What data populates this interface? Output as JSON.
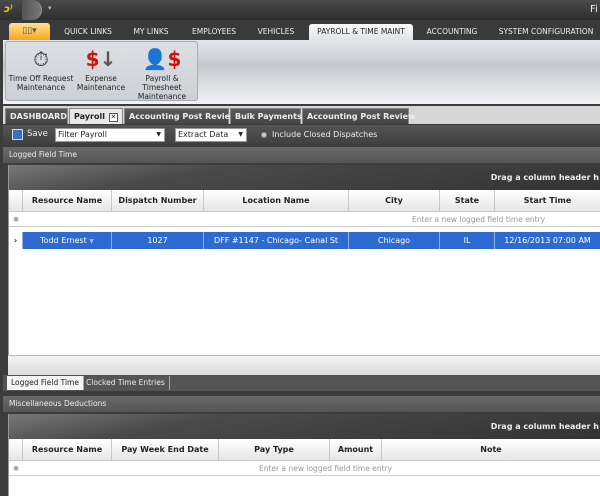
{
  "window": {
    "title": "Fi"
  },
  "ribbon": {
    "tabs": [
      "QUICK LINKS",
      "MY LINKS",
      "EMPLOYEES",
      "VEHICLES",
      "PAYROLL & TIME MAINT",
      "ACCOUNTING",
      "SYSTEM CONFIGURATION"
    ],
    "selected_tab": "PAYROLL & TIME MAINT",
    "buttons": [
      {
        "label1": "Time Off Request",
        "label2": "Maintenance",
        "icon": "stopwatch-icon"
      },
      {
        "label1": "Expense",
        "label2": "Maintenance",
        "icon": "dollar-down-icon"
      },
      {
        "label1": "Payroll & Timesheet",
        "label2": "Maintenance",
        "icon": "person-dollar-icon"
      }
    ]
  },
  "doc_tabs": [
    "DASHBOARD",
    "Payroll",
    "Accounting Post Review",
    "Bulk Payments",
    "Accounting Post Review"
  ],
  "toolbar": {
    "save": "Save",
    "filter": "Filter Payroll",
    "extract": "Extract Data",
    "include_closed": "Include Closed Dispatches"
  },
  "logged": {
    "header": "Logged Field Time",
    "group_hint": "Drag a column header h",
    "columns": [
      "Resource Name",
      "Dispatch Number",
      "Location Name",
      "City",
      "State",
      "Start Time"
    ],
    "new_row": "Enter a new logged field time entry",
    "rows": [
      {
        "resource": "Todd  Ernest",
        "dispatch": "1027",
        "location": "DFF #1147 - Chicago- Canal St",
        "city": "Chicago",
        "state": "IL",
        "start": "12/16/2013 07:00 AM"
      }
    ]
  },
  "bottom_tabs": [
    "Logged Field Time",
    "Clocked Time Entries"
  ],
  "misc": {
    "header": "Miscellaneous Deductions",
    "group_hint": "Drag a column header h",
    "columns": [
      "Resource Name",
      "Pay Week End Date",
      "Pay Type",
      "Amount",
      "Note"
    ],
    "new_row": "Enter a new logged field time entry"
  }
}
